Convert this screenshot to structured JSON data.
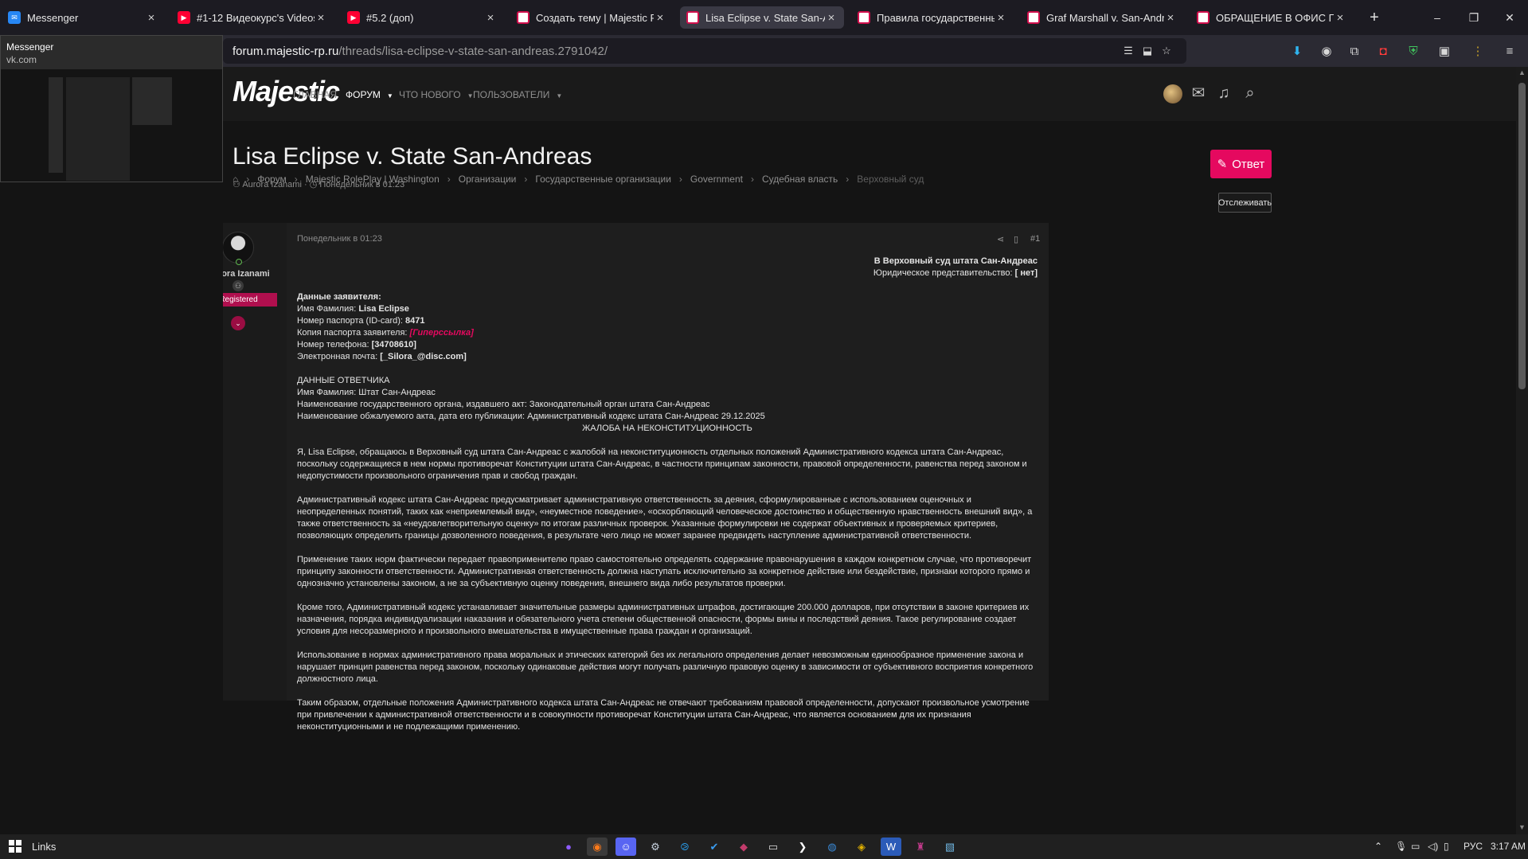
{
  "tabs": [
    {
      "title": "Messenger",
      "icon": "messenger-icon",
      "active": false
    },
    {
      "title": "#1-12 Видеокурс's Videos",
      "icon": "youtube-icon",
      "active": false
    },
    {
      "title": "#5.2 (доп)",
      "icon": "youtube-icon",
      "active": false
    },
    {
      "title": "Создать тему | Majestic Role",
      "icon": "majestic-icon",
      "active": false
    },
    {
      "title": "Lisa Eclipse v. State San-Andr",
      "icon": "majestic-icon",
      "active": true
    },
    {
      "title": "Правила государственных ор",
      "icon": "majestic-icon",
      "active": false
    },
    {
      "title": "Graf Marshall v. San-Andreas",
      "icon": "majestic-icon",
      "active": false
    },
    {
      "title": "ОБРАЩЕНИЕ В ОФИС ГЕНЕР",
      "icon": "majestic-icon",
      "active": false
    }
  ],
  "preview": {
    "title": "Messenger",
    "url": "vk.com"
  },
  "address": {
    "host": "forum.majestic-rp.ru",
    "path": "/threads/lisa-eclipse-v-state-san-andreas.2791042/"
  },
  "site": {
    "logo": "Majestic",
    "nav": [
      {
        "label": "ГЛАВНАЯ",
        "caret": false,
        "active": false
      },
      {
        "label": "ФОРУМ",
        "caret": true,
        "active": true
      },
      {
        "label": "ЧТО НОВОГО",
        "caret": true,
        "active": false
      },
      {
        "label": "ПОЛЬЗОВАТЕЛИ",
        "caret": true,
        "active": false
      }
    ]
  },
  "thread": {
    "title": "Lisa Eclipse v. State San-Andreas",
    "author": "Aurora Izanami",
    "date": "Понедельник в 01:23",
    "reply_label": "Ответ",
    "watch_label": "Отслеживать",
    "breadcrumbs": [
      "Форум",
      "Majestic RolePlay | Washington",
      "Организации",
      "Государственные организации",
      "Government",
      "Судебная власть",
      "Верховный суд"
    ]
  },
  "post": {
    "username": "Aurora Izanami",
    "role": "Registered",
    "date": "Понедельник в 01:23",
    "number": "#1",
    "court_header": "В Верховный суд штата Сан-Андреас",
    "representation_label": "Юридическое представительство:",
    "representation_value": "[ нет]",
    "applicant_heading": "Данные заявителя:",
    "name_label": "Имя Фамилия:",
    "name_value": "Lisa Eclipse",
    "passport_label": "Номер паспорта (ID-card):",
    "passport_value": "8471",
    "copy_label": "Копия паспорта заявителя:",
    "copy_link": "[Гиперссылка]",
    "phone_label": "Номер телефона:",
    "phone_value": "[34708610]",
    "email_label": "Электронная почта:",
    "email_value": "[_Silora_@disc.com]",
    "respondent_heading": "ДАННЫЕ ОТВЕТЧИКА",
    "respondent_name": "Имя Фамилия: Штат Сан-Андреас",
    "respondent_organ": "Наименование государственного органа, издавшего акт: Законодательный орган штата Сан-Андреас",
    "respondent_act": "Наименование обжалуемого акта, дата его публикации: Административный кодекс штата Сан-Андреас 29.12.2025",
    "complaint_title": "ЖАЛОБА НА НЕКОНСТИТУЦИОННОСТЬ",
    "paragraphs": [
      "Я, Lisa Eclipse, обращаюсь в Верховный суд штата Сан-Андреас с жалобой на неконституционность отдельных положений Административного кодекса штата Сан-Андреас, поскольку содержащиеся в нем нормы противоречат Конституции штата Сан-Андреас, в частности принципам законности, правовой определенности, равенства перед законом и недопустимости произвольного ограничения прав и свобод граждан.",
      "Административный кодекс штата Сан-Андреас предусматривает административную ответственность за деяния, сформулированные с использованием оценочных и неопределенных понятий, таких как «неприемлемый вид», «неуместное поведение», «оскорбляющий человеческое достоинство и общественную нравственность внешний вид», а также ответственность за «неудовлетворительную оценку» по итогам различных проверок. Указанные формулировки не содержат объективных и проверяемых критериев, позволяющих определить границы дозволенного поведения, в результате чего лицо не может заранее предвидеть наступление административной ответственности.",
      "Применение таких норм фактически передает правоприменителю право самостоятельно определять содержание правонарушения в каждом конкретном случае, что противоречит принципу законности ответственности. Административная ответственность должна наступать исключительно за конкретное действие или бездействие, признаки которого прямо и однозначно установлены законом, а не за субъективную оценку поведения, внешнего вида либо результатов проверки.",
      "Кроме того, Административный кодекс устанавливает значительные размеры административных штрафов, достигающие 200.000 долларов, при отсутствии в законе критериев их назначения, порядка индивидуализации наказания и обязательного учета степени общественной опасности, формы вины и последствий деяния. Такое регулирование создает условия для несоразмерного и произвольного вмешательства в имущественные права граждан и организаций.",
      "Использование в нормах административного права моральных и этических категорий без их легального определения делает невозможным единообразное применение закона и нарушает принцип равенства перед законом, поскольку одинаковые действия могут получать различную правовую оценку в зависимости от субъективного восприятия конкретного должностного лица.",
      "Таким образом, отдельные положения Административного кодекса штата Сан-Андреас не отвечают требованиям правовой определенности, допускают произвольное усмотрение при привлечении к административной ответственности и в совокупности противоречат Конституции штата Сан-Андреас, что является основанием для их признания неконституционными и не подлежащими применению."
    ]
  },
  "taskbar": {
    "start_label": "Links",
    "language": "РУС",
    "time": "3:17 AM"
  },
  "colors": {
    "accent": "#e5095f",
    "role_badge": "#b00f4e"
  }
}
